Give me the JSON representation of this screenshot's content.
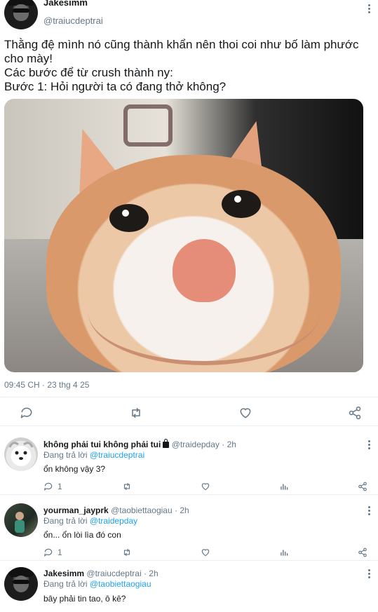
{
  "main_tweet": {
    "author_name": "Jakesimm",
    "author_handle": "@traiucdeptrai",
    "text_lines": [
      "Thằng đệ mình nó cũng thành khẩn nên thoi coi như bố làm phước cho mày!",
      "Các bước để từ crush thành ny:",
      "Bước 1: Hỏi người ta có đang thở không?"
    ],
    "timestamp": "09:45 CH · 23 thg 4 25",
    "media_alt": "smiling-cat-photo",
    "actions": [
      "reply-icon",
      "retweet-icon",
      "like-icon",
      "share-icon"
    ]
  },
  "replies": [
    {
      "name": "không phải tui không phải tui",
      "handle": "@traidepday",
      "time": "· 2h",
      "replying_label": "Đang trả lời",
      "replying_to": "@traiucdeptrai",
      "text": "ổn không vậy 3?",
      "reply_count": "1",
      "locked": true
    },
    {
      "name": "yourman_jayprk",
      "handle": "@taobiettaogiau",
      "time": "· 2h",
      "replying_label": "Đang trả lời",
      "replying_to": "@traidepday",
      "text": "ổn... ổn lòi lìa đó con",
      "reply_count": "1",
      "locked": false
    },
    {
      "name": "Jakesimm",
      "handle": "@traiucdeptrai",
      "time": "· 2h",
      "replying_label": "Đang trả lời",
      "replying_to": "@taobiettaogiau",
      "text": "bây phải tin tao, ô kê?",
      "reply_count": "",
      "locked": false
    }
  ],
  "colors": {
    "text": "#14171a",
    "secondary": "#657786",
    "link": "#1da1f2",
    "divider": "#ebeef0"
  }
}
